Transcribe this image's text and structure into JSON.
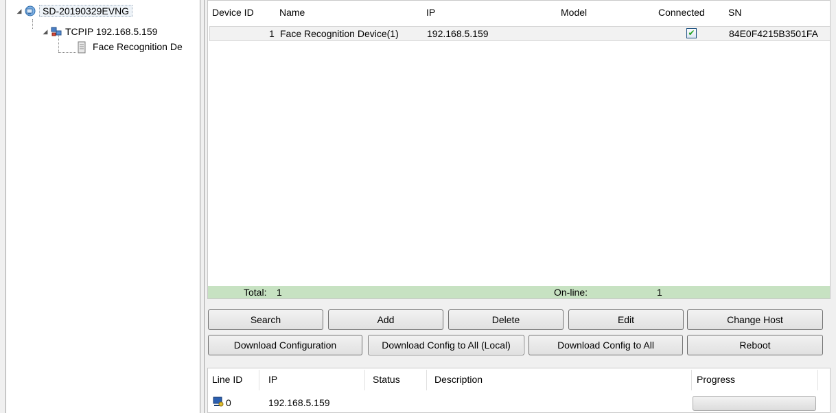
{
  "tree": {
    "root_label": "SD-20190329EVNG",
    "root_icon": "computer-network-icon",
    "connection_label": "TCPIP 192.168.5.159",
    "connection_icon": "network-connection-icon",
    "device_label": "Face Recognition De",
    "device_icon": "device-icon"
  },
  "device_grid": {
    "columns": [
      "Device ID",
      "Name",
      "IP",
      "Model",
      "Connected",
      "SN"
    ],
    "rows": [
      {
        "device_id": "1",
        "name": "Face Recognition Device(1)",
        "ip": "192.168.5.159",
        "model": "",
        "connected": true,
        "sn": "84E0F4215B3501FA"
      }
    ]
  },
  "status_bar": {
    "total_label": "Total:",
    "total_value": "1",
    "online_label": "On-line:",
    "online_value": "1",
    "background": "#c7e2c2"
  },
  "buttons": {
    "search": "Search",
    "add": "Add",
    "delete": "Delete",
    "edit": "Edit",
    "change_host": "Change Host",
    "download_configuration": "Download Configuration",
    "download_config_all_local": "Download Config to All (Local)",
    "download_config_all": "Download Config to All",
    "reboot": "Reboot"
  },
  "lines_grid": {
    "columns": [
      "Line ID",
      "IP",
      "Status",
      "Description",
      "Progress"
    ],
    "rows": [
      {
        "line_id": "0",
        "ip": "192.168.5.159",
        "status": "",
        "description": "",
        "progress": 0,
        "icon": "network-line-icon"
      }
    ]
  }
}
